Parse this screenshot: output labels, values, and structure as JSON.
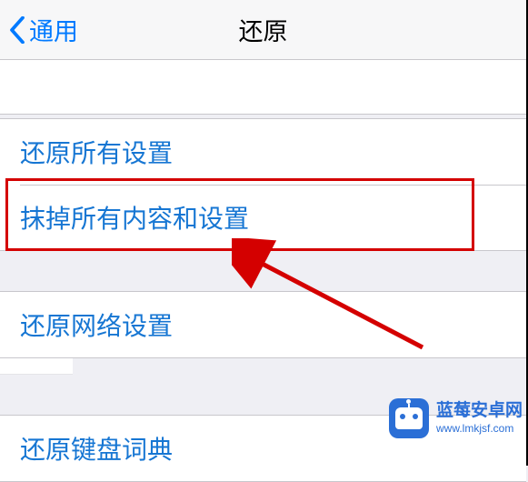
{
  "nav": {
    "back_label": "通用",
    "title": "还原"
  },
  "groups": [
    {
      "items": [
        {
          "label": "还原所有设置"
        },
        {
          "label": "抹掉所有内容和设置"
        }
      ]
    },
    {
      "items": [
        {
          "label": "还原网络设置"
        }
      ]
    },
    {
      "items": [
        {
          "label": "还原键盘词典"
        }
      ]
    }
  ],
  "watermark": {
    "title": "蓝莓安卓网",
    "url": "www.lmkjsf.com"
  },
  "colors": {
    "link": "#1676d3",
    "accent": "#007aff",
    "highlight": "#d40000",
    "watermark": "#2b6fd6"
  }
}
